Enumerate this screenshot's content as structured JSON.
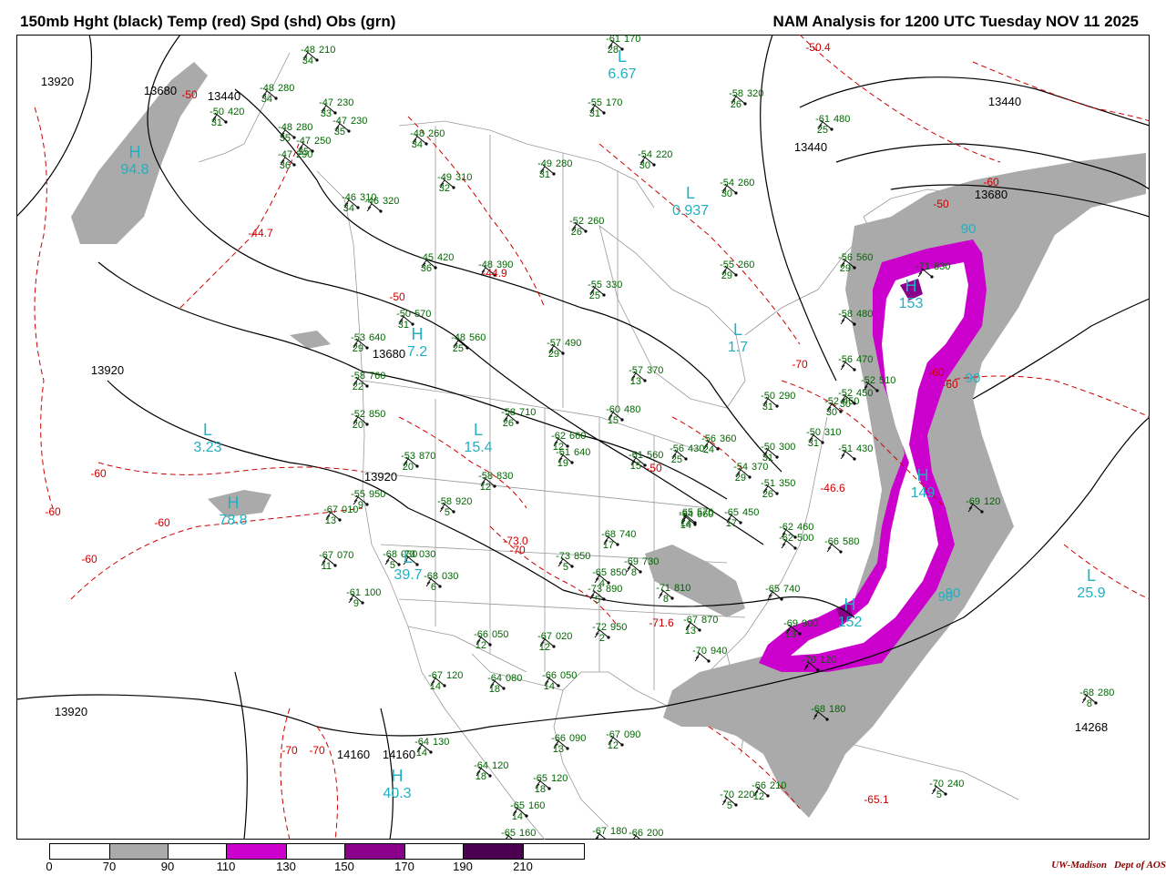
{
  "header": {
    "title_left": "150mb Hght (black) Temp (red) Spd (shd) Obs (grn)",
    "title_right": "NAM Analysis for 1200 UTC Tuesday  NOV 11 2025"
  },
  "colors": {
    "height": "#000000",
    "temperature": "#cc0000",
    "obs": "#006600",
    "center_cyan": "#20b0c0",
    "speed_70_90": "#aaaaaa",
    "speed_110_130": "#cc00cc",
    "speed_150_170": "#8b008b",
    "speed_190_210": "#4b0050"
  },
  "height_labels": [
    "13920",
    "13680",
    "13440",
    "13440",
    "13440",
    "13680",
    "13920",
    "13680",
    "13920",
    "13920",
    "14160",
    "14160",
    "14268"
  ],
  "temp_labels": [
    "-50",
    "-60",
    "-60",
    "-60",
    "-60",
    "-60",
    "-50",
    "-50",
    "-70",
    "-70",
    "-70",
    "-60",
    "-60",
    "-50",
    "-70",
    "-50.4",
    "-44.7",
    "-44.9",
    "-46.6",
    "-71.6",
    "-73.0",
    "-65.1"
  ],
  "pressure_centers": [
    {
      "letter": "H",
      "value": "94.8"
    },
    {
      "letter": "L",
      "value": "3.23"
    },
    {
      "letter": "H",
      "value": "78.8"
    },
    {
      "letter": "L",
      "value": "6.67"
    },
    {
      "letter": "L",
      "value": "0.937"
    },
    {
      "letter": "L",
      "value": "1.7"
    },
    {
      "letter": "L",
      "value": "15.4"
    },
    {
      "letter": "H",
      "value": "7.2"
    },
    {
      "letter": "L",
      "value": "39.7"
    },
    {
      "letter": "H",
      "value": "40.3"
    },
    {
      "letter": "H",
      "value": "149"
    },
    {
      "letter": "H",
      "value": "152"
    },
    {
      "letter": "L",
      "value": "25.9"
    },
    {
      "letter": "H",
      "value": "153"
    }
  ],
  "speed_labels": [
    "90",
    "90",
    "90",
    "90"
  ],
  "obs": [
    [
      "-48",
      "210",
      "34"
    ],
    [
      "-48",
      "280",
      "34"
    ],
    [
      "-47",
      "230",
      "33"
    ],
    [
      "-47",
      "230",
      "35"
    ],
    [
      "-48",
      "280",
      "35"
    ],
    [
      "-47",
      "250",
      "35"
    ],
    [
      "-47",
      "290",
      "36"
    ],
    [
      "-46",
      "310",
      "34"
    ],
    [
      "-46",
      "320",
      ""
    ],
    [
      "-50",
      "420",
      "31"
    ],
    [
      "-48",
      "260",
      "34"
    ],
    [
      "-49",
      "310",
      "32"
    ],
    [
      "-45",
      "420",
      "36"
    ],
    [
      "-48",
      "390",
      ""
    ],
    [
      "-55",
      "330",
      "25"
    ],
    [
      "-52",
      "260",
      "26"
    ],
    [
      "-49",
      "280",
      "31"
    ],
    [
      "-54",
      "260",
      "30"
    ],
    [
      "-54",
      "220",
      "30"
    ],
    [
      "-55",
      "260",
      "29"
    ],
    [
      "-55",
      "170",
      "31"
    ],
    [
      "-58",
      "320",
      "26"
    ],
    [
      "-61",
      "480",
      "25"
    ],
    [
      "-61",
      "170",
      "28"
    ],
    [
      "-50",
      "570",
      "31"
    ],
    [
      "-48",
      "560",
      "25"
    ],
    [
      "-53",
      "640",
      "29"
    ],
    [
      "-58",
      "760",
      "22"
    ],
    [
      "-52",
      "850",
      "20"
    ],
    [
      "-58",
      "710",
      "26"
    ],
    [
      "-57",
      "490",
      "29"
    ],
    [
      "-57",
      "370",
      "13"
    ],
    [
      "-60",
      "480",
      "15"
    ],
    [
      "-62",
      "660",
      "12"
    ],
    [
      "-61",
      "640",
      "19"
    ],
    [
      "-61",
      "560",
      "15"
    ],
    [
      "-56",
      "430",
      "25"
    ],
    [
      "-56",
      "360",
      "24"
    ],
    [
      "-54",
      "370",
      "29"
    ],
    [
      "-50",
      "290",
      "31"
    ],
    [
      "-50",
      "300",
      "31"
    ],
    [
      "-51",
      "350",
      "26"
    ],
    [
      "-50",
      "310",
      "31"
    ],
    [
      "-51",
      "430",
      ""
    ],
    [
      "-52",
      "450",
      "30"
    ],
    [
      "-53",
      "870",
      "20"
    ],
    [
      "-55",
      "950",
      "9"
    ],
    [
      "-58",
      "920",
      "5"
    ],
    [
      "-58",
      "830",
      "12"
    ],
    [
      "-67",
      "010",
      "13"
    ],
    [
      "-68",
      "030",
      "5"
    ],
    [
      "-67",
      "070",
      "11"
    ],
    [
      "-68",
      "030",
      "6"
    ],
    [
      "-61",
      "100",
      "9"
    ],
    [
      "-73",
      "850",
      "5"
    ],
    [
      "-65",
      "850",
      "4"
    ],
    [
      "-68",
      "740",
      "17"
    ],
    [
      "-69",
      "730",
      "8"
    ],
    [
      "-71",
      "810",
      "8"
    ],
    [
      "-64",
      "660",
      "14"
    ],
    [
      "-65",
      "570",
      "14"
    ],
    [
      "-65",
      "450",
      "17"
    ],
    [
      "-62",
      "460",
      ""
    ],
    [
      "-62",
      "500",
      ""
    ],
    [
      "-66",
      "580",
      ""
    ],
    [
      "-65",
      "740",
      ""
    ],
    [
      "-67",
      "870",
      "13"
    ],
    [
      "-69",
      "900",
      "13"
    ],
    [
      "-73",
      "890",
      "5"
    ],
    [
      "-72",
      "950",
      "2"
    ],
    [
      "-66",
      "050",
      "12"
    ],
    [
      "-67",
      "020",
      "12"
    ],
    [
      "-66",
      "050",
      "14"
    ],
    [
      "-67",
      "120",
      "14"
    ],
    [
      "-64",
      "080",
      "18"
    ],
    [
      "-64",
      "130",
      "14"
    ],
    [
      "-64",
      "120",
      "18"
    ],
    [
      "-66",
      "090",
      "13"
    ],
    [
      "-67",
      "090",
      "12"
    ],
    [
      "-65",
      "120",
      "18"
    ],
    [
      "-65",
      "160",
      "14"
    ],
    [
      "-65",
      "160",
      ""
    ],
    [
      "-67",
      "180",
      ""
    ],
    [
      "-66",
      "200",
      ""
    ],
    [
      "-70",
      "220",
      "5"
    ],
    [
      "-66",
      "210",
      "12"
    ],
    [
      "-68",
      "180",
      ""
    ],
    [
      "-70",
      "240",
      "5"
    ],
    [
      "-69",
      "120",
      ""
    ],
    [
      "-68",
      "280",
      "8"
    ],
    [
      "-70",
      "940",
      ""
    ],
    [
      "-70",
      "120",
      ""
    ],
    [
      "-73",
      "030",
      ""
    ],
    [
      "-71",
      "830",
      ""
    ],
    [
      "-56",
      "560",
      "29"
    ],
    [
      "-58",
      "480",
      ""
    ],
    [
      "-56",
      "470",
      ""
    ],
    [
      "-52",
      "510",
      ""
    ],
    [
      "-52",
      "450",
      "30"
    ]
  ],
  "colorbar": {
    "ticks": [
      "0",
      "70",
      "90",
      "110",
      "130",
      "150",
      "170",
      "190",
      "210"
    ],
    "segments": [
      {
        "color": "#ffffff"
      },
      {
        "color": "#aaaaaa"
      },
      {
        "color": "#ffffff"
      },
      {
        "color": "#cc00cc"
      },
      {
        "color": "#ffffff"
      },
      {
        "color": "#8b008b"
      },
      {
        "color": "#ffffff"
      },
      {
        "color": "#4b0050"
      },
      {
        "color": "#ffffff"
      }
    ]
  },
  "credit": {
    "left": "UW-Madison",
    "right": "Dept of AOS"
  }
}
